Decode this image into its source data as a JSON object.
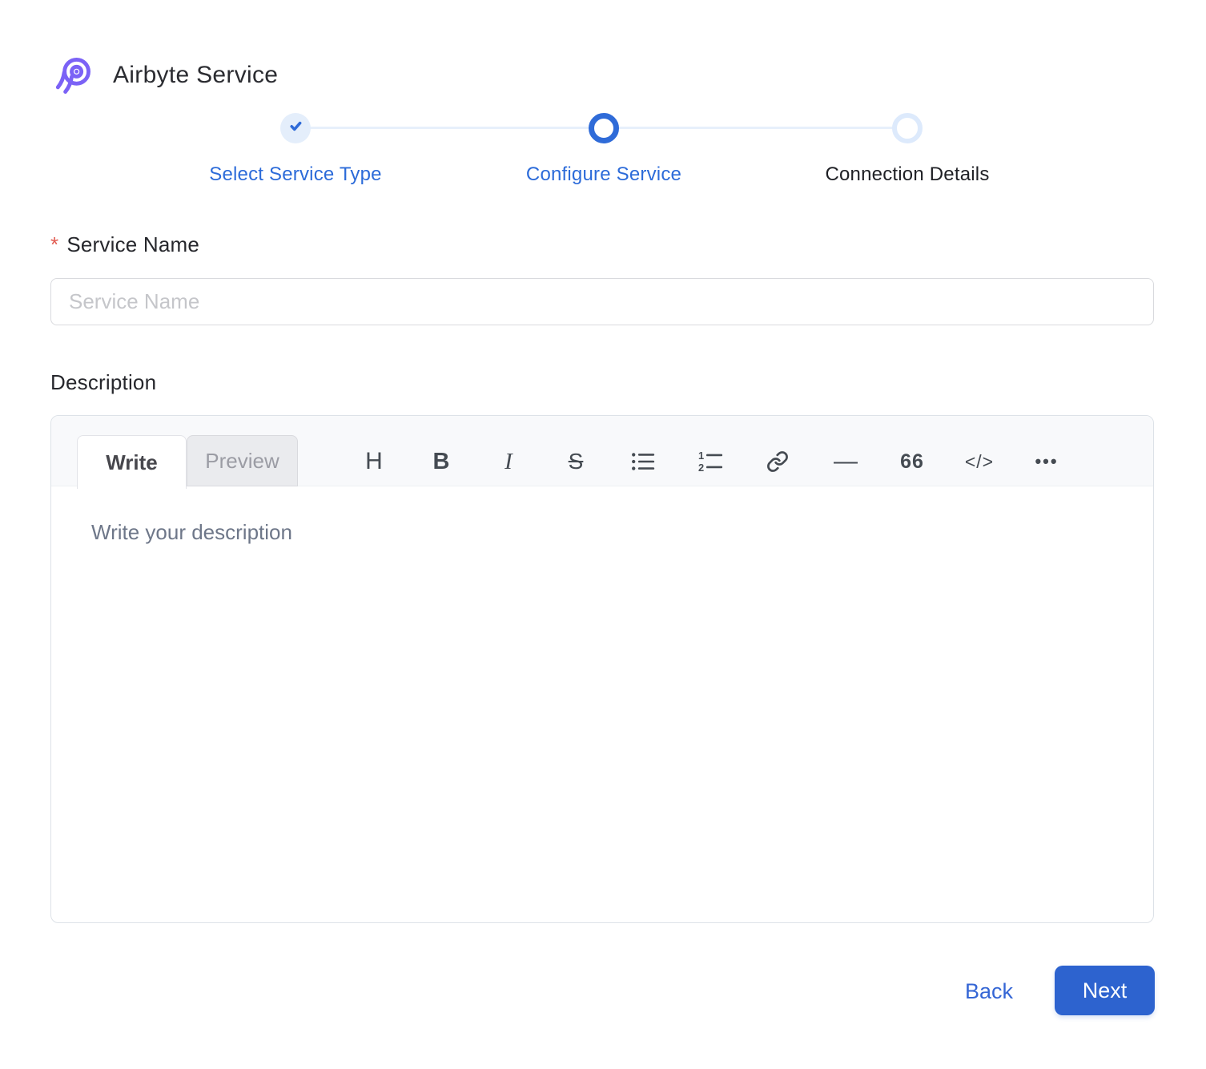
{
  "app": {
    "title": "Airbyte Service"
  },
  "stepper": {
    "steps": [
      {
        "label": "Select Service Type",
        "state": "completed"
      },
      {
        "label": "Configure Service",
        "state": "active"
      },
      {
        "label": "Connection Details",
        "state": "upcoming"
      }
    ]
  },
  "form": {
    "service_name": {
      "label": "Service Name",
      "required_marker": "*",
      "placeholder": "Service Name",
      "value": ""
    },
    "description": {
      "label": "Description",
      "placeholder": "Write your description",
      "value": ""
    }
  },
  "editor": {
    "tabs": [
      {
        "label": "Write",
        "active": true
      },
      {
        "label": "Preview",
        "active": false
      }
    ],
    "toolbar": [
      {
        "name": "heading-icon",
        "glyph": "H"
      },
      {
        "name": "bold-icon",
        "glyph": "B"
      },
      {
        "name": "italic-icon",
        "glyph": "I"
      },
      {
        "name": "strikethrough-icon",
        "glyph": "S"
      },
      {
        "name": "unordered-list-icon",
        "glyph": ""
      },
      {
        "name": "ordered-list-icon",
        "glyph": ""
      },
      {
        "name": "link-icon",
        "glyph": ""
      },
      {
        "name": "horizontal-rule-icon",
        "glyph": "—"
      },
      {
        "name": "quote-icon",
        "glyph": "66"
      },
      {
        "name": "code-icon",
        "glyph": "</>"
      },
      {
        "name": "more-icon",
        "glyph": "•••"
      }
    ]
  },
  "footer": {
    "back_label": "Back",
    "next_label": "Next"
  },
  "colors": {
    "brand_purple": "#7b62f6",
    "primary_blue": "#2c6bd9",
    "button_blue": "#2d63cf",
    "inactive_light_blue": "#ddeafc",
    "completed_step_bg": "#e4eefb",
    "asterisk_red": "#e25c52",
    "toolbar_icon": "#454b52",
    "placeholder_gray": "#c5c6ca",
    "editor_placeholder": "#6e7789"
  }
}
